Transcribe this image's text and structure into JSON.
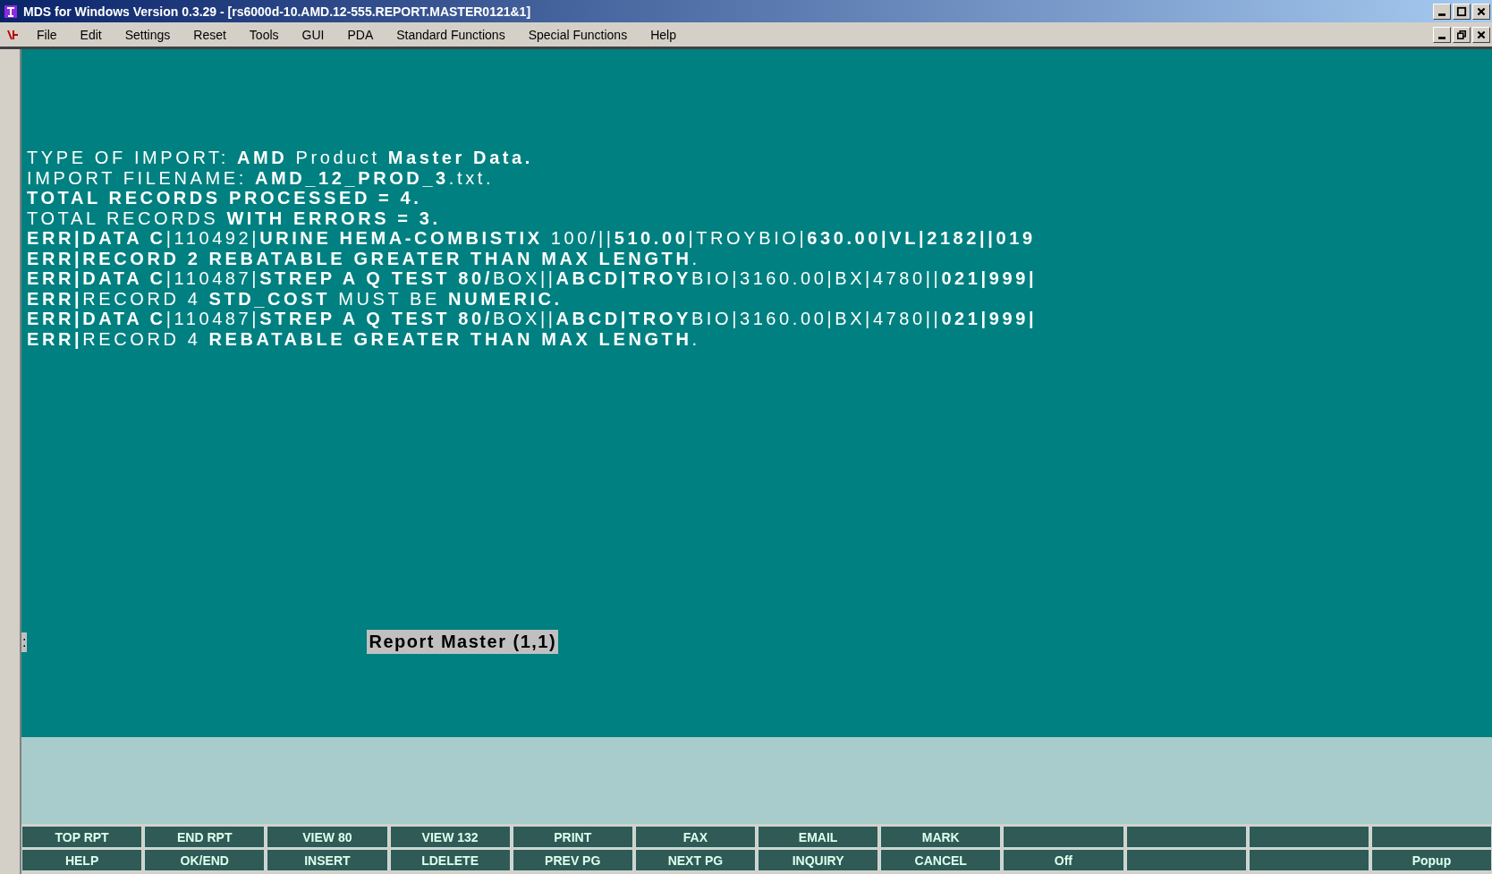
{
  "window": {
    "title": "MDS for Windows Version 0.3.29 - [rs6000d-10.AMD.12-555.REPORT.MASTER0121&1]"
  },
  "menu": [
    "File",
    "Edit",
    "Settings",
    "Reset",
    "Tools",
    "GUI",
    "PDA",
    "Standard Functions",
    "Special Functions",
    "Help"
  ],
  "report_lines": [
    {
      "text": "TYPE OF IMPORT:  **AMD** Product **Master Data.**",
      "bold": false
    },
    {
      "text": "IMPORT FILENAME: **AMD_12_PROD_3**.txt.",
      "bold": false
    },
    {
      "text": "TOTAL RECORDS PROCESSED = 4.",
      "bold": true
    },
    {
      "text": "TOTAL RECORDS **WITH ERRORS = 3.**",
      "bold": false
    },
    {
      "text": "**ERR|DATA C**|110492|**URINE HEMA-COMBISTIX** 100/||**510.00**|TROYBIO|**630.00|VL|2182||019**",
      "bold": false
    },
    {
      "text": "**ERR|RECORD 2 REBATABLE GREATER THAN MAX LENGTH**.",
      "bold": false
    },
    {
      "text": "**ERR|DATA C**|110487|**STREP A Q TEST 80/**BOX||**ABCD|TROY**BIO|3160.00|BX|4780||**021|999|**",
      "bold": false
    },
    {
      "text": "**ERR|**RECORD 4 **STD_COST** MUST BE **NUMERIC.**",
      "bold": false
    },
    {
      "text": "**ERR|DATA C**|110487|**STREP A Q TEST 80/**BOX||**ABCD|TROY**BIO|3160.00|BX|4780||**021|999|**",
      "bold": false
    },
    {
      "text": "**ERR|**RECORD 4 **REBATABLE GREATER THAN MAX LENGTH**.",
      "bold": false
    }
  ],
  "prompt": ":",
  "status_label": "Report Master (1,1)",
  "function_keys": [
    [
      {
        "kind": "key",
        "label": "TOP RPT"
      },
      {
        "kind": "key",
        "label": "END RPT"
      },
      {
        "kind": "key",
        "label": "VIEW 80"
      },
      {
        "kind": "key",
        "label": "VIEW 132"
      },
      {
        "kind": "key",
        "label": "PRINT"
      },
      {
        "kind": "key",
        "label": "FAX"
      },
      {
        "kind": "key",
        "label": "EMAIL"
      },
      {
        "kind": "key",
        "label": "MARK"
      },
      {
        "kind": "blank"
      },
      {
        "kind": "blank"
      },
      {
        "kind": "blank"
      },
      {
        "kind": "blank"
      }
    ],
    [
      {
        "kind": "key",
        "label": "HELP"
      },
      {
        "kind": "key",
        "label": "OK/END"
      },
      {
        "kind": "key",
        "label": "INSERT"
      },
      {
        "kind": "key",
        "label": "LDELETE"
      },
      {
        "kind": "key",
        "label": "PREV PG"
      },
      {
        "kind": "key",
        "label": "NEXT PG"
      },
      {
        "kind": "key",
        "label": "INQUIRY"
      },
      {
        "kind": "key",
        "label": "CANCEL"
      },
      {
        "kind": "key",
        "label": "Off"
      },
      {
        "kind": "blank"
      },
      {
        "kind": "blank"
      },
      {
        "kind": "key",
        "label": "Popup"
      }
    ]
  ]
}
